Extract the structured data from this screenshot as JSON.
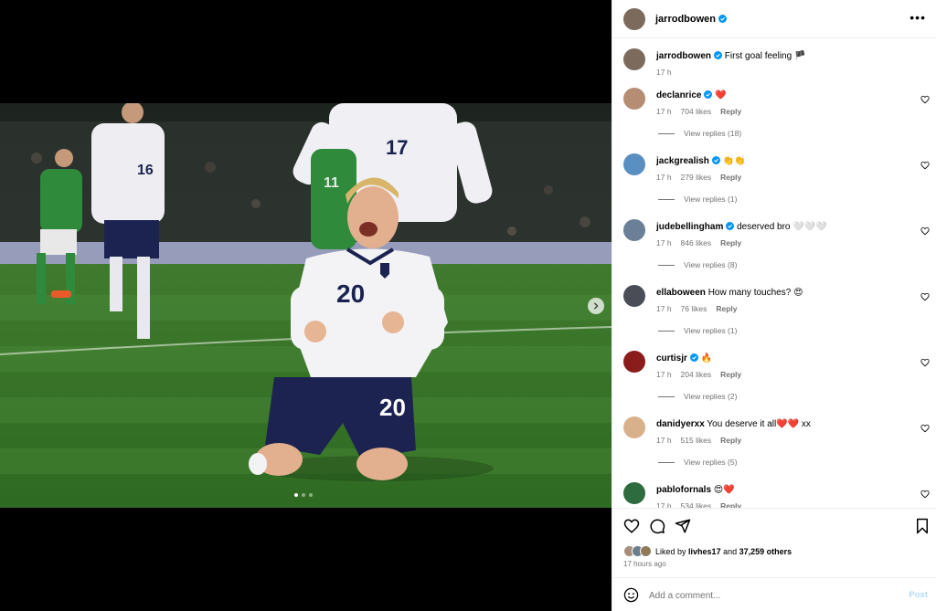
{
  "post": {
    "author": "jarrodbowen",
    "caption": "First goal feeling",
    "caption_flag": "🏴",
    "caption_time": "17 h",
    "carousel": {
      "count": 3,
      "active": 0
    }
  },
  "comments": [
    {
      "user": "declanrice",
      "verified": true,
      "text": "❤️",
      "time": "17 h",
      "likes": "704 likes",
      "reply": "Reply",
      "view_replies": "View replies (18)",
      "avatar_color": "#b58d74"
    },
    {
      "user": "jackgrealish",
      "verified": true,
      "text": "👏👏",
      "time": "17 h",
      "likes": "279 likes",
      "reply": "Reply",
      "view_replies": "View replies (1)",
      "avatar_color": "#5a8fc2"
    },
    {
      "user": "judebellingham",
      "verified": true,
      "text": "deserved bro 🤍🤍🤍",
      "time": "17 h",
      "likes": "846 likes",
      "reply": "Reply",
      "view_replies": "View replies (8)",
      "avatar_color": "#6b7f96"
    },
    {
      "user": "ellaboween",
      "verified": false,
      "text": "How many touches? 😍",
      "time": "17 h",
      "likes": "76 likes",
      "reply": "Reply",
      "view_replies": "View replies (1)",
      "avatar_color": "#4a4d56"
    },
    {
      "user": "curtisjr",
      "verified": true,
      "text": "🔥",
      "time": "17 h",
      "likes": "204 likes",
      "reply": "Reply",
      "view_replies": "View replies (2)",
      "avatar_color": "#8b1c1c"
    },
    {
      "user": "danidyerxx",
      "verified": false,
      "text": "You deserve it all❤️❤️ xx",
      "time": "17 h",
      "likes": "515 likes",
      "reply": "Reply",
      "view_replies": "View replies (5)",
      "avatar_color": "#d9b08c"
    },
    {
      "user": "pablofornals",
      "verified": false,
      "text": "😍❤️",
      "time": "17 h",
      "likes": "534 likes",
      "reply": "Reply",
      "view_replies": "",
      "avatar_color": "#2e6b3f"
    }
  ],
  "engagement": {
    "liked_by_prefix": "Liked by",
    "liked_by_user": "livhes17",
    "and": "and",
    "others": "37,259 others",
    "time_ago": "17 hours ago"
  },
  "composer": {
    "placeholder": "Add a comment...",
    "post_label": "Post"
  },
  "colors": {
    "verified": "#0095f6",
    "heart": "#ed4956",
    "muted": "#737373",
    "post_disabled": "#b3dbff"
  },
  "icons": [
    "more-icon",
    "heart-icon",
    "comment-icon",
    "share-icon",
    "save-icon",
    "emoji-icon",
    "chevron-right-icon",
    "verified-icon"
  ]
}
